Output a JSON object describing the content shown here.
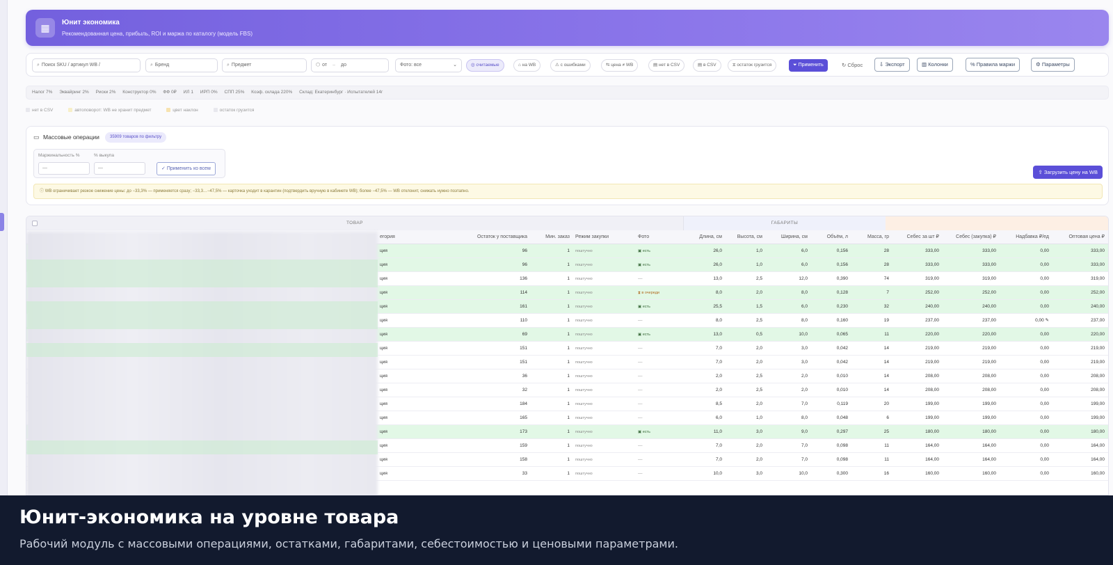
{
  "hero": {
    "title": "Юнит экономика",
    "subtitle": "Рекомендованная цена, прибыль, ROI и маржа по каталогу (модель FBS)"
  },
  "toolbar": {
    "search_placeholder": "Поиск SKU / артикул WB /",
    "brand_placeholder": "Бренд",
    "subject_placeholder": "Предмет",
    "from_placeholder": "от",
    "to_placeholder": "до",
    "photo_select": "Фото: все",
    "chips": [
      "считаемые",
      "на WB",
      "с ошибками",
      "цена ≠ WB",
      "нет в CSV",
      "в CSV",
      "остаток грузится"
    ],
    "apply": "Применить",
    "reset": "Сброс",
    "export": "Экспорт",
    "columns": "Колонки",
    "margin_rules": "Правила маржи",
    "parameters": "Параметры"
  },
  "params": [
    "Налог 7%",
    "Эквайринг 2%",
    "Риски 2%",
    "Конструктор 0%",
    "ФФ 0₽",
    "ИЛ 1",
    "ИРП 0%",
    "СПП 25%",
    "Коэф. склада 220%",
    "Склад: Екатеринбург · Испытателей 14г"
  ],
  "legend": [
    {
      "label": "нет в CSV",
      "color": "#e8e8ee"
    },
    {
      "label": "автоповорот: WB не хранит предмет",
      "color": "#f7efc8"
    },
    {
      "label": "цвет наклон",
      "color": "#f7e3b0"
    },
    {
      "label": "остаток грузится",
      "color": "#e8e8ee"
    }
  ],
  "mass": {
    "title": "Массовые операции",
    "badge": "35909 товаров по фильтру",
    "margin_label": "Маржинальность %",
    "payout_label": "% выкупа",
    "margin_value": "—",
    "payout_value": "—",
    "apply_all": "Применить ко всем",
    "upload": "Загрузить цену на WB",
    "warning": "WB ограничивает резкое снижение цены: до −33,3% — применяется сразу; −33,3…−47,5% — карточка уходит в карантин (подтвердить вручную в кабинете WB); более −47,5% — WB отклонит, снижать нужно поэтапно."
  },
  "table": {
    "group_product": "ТОВАР",
    "group_dims": "ГАБАРИТЫ",
    "headers": [
      "егория",
      "Остаток у поставщика",
      "Мин. заказ",
      "Режим закупки",
      "Фото",
      "Длина, см",
      "Высота, см",
      "Ширина, см",
      "Объём, л",
      "Масса, гр",
      "Себес за шт ₽",
      "Себес (закупка) ₽",
      "Надбавка ₽/ед",
      "Оптовая цена ₽"
    ],
    "rows": [
      {
        "cat": "ция",
        "stock": "96",
        "min": "1",
        "mode": "поштучно",
        "photo": "есть",
        "l": "26,0",
        "h": "1,0",
        "w": "6,0",
        "vol": "0,156",
        "mass": "28",
        "cost": "333,00",
        "buy": "333,00",
        "markup": "0,00",
        "wholesale": "333,00",
        "style": "green"
      },
      {
        "cat": "ция",
        "stock": "96",
        "min": "1",
        "mode": "поштучно",
        "photo": "есть",
        "l": "26,0",
        "h": "1,0",
        "w": "6,0",
        "vol": "0,156",
        "mass": "28",
        "cost": "333,00",
        "buy": "333,00",
        "markup": "0,00",
        "wholesale": "333,00",
        "style": "green"
      },
      {
        "cat": "ция",
        "stock": "136",
        "min": "1",
        "mode": "поштучно",
        "photo": "—",
        "l": "13,0",
        "h": "2,5",
        "w": "12,0",
        "vol": "0,390",
        "mass": "74",
        "cost": "319,00",
        "buy": "319,00",
        "markup": "0,00",
        "wholesale": "319,00",
        "style": "white"
      },
      {
        "cat": "ция",
        "stock": "114",
        "min": "1",
        "mode": "поштучно",
        "photo": "в очереди",
        "l": "8,0",
        "h": "2,0",
        "w": "8,0",
        "vol": "0,128",
        "mass": "7",
        "cost": "252,00",
        "buy": "252,00",
        "markup": "0,00",
        "wholesale": "252,00",
        "style": "green"
      },
      {
        "cat": "ция",
        "stock": "161",
        "min": "1",
        "mode": "поштучно",
        "photo": "есть",
        "l": "25,5",
        "h": "1,5",
        "w": "6,0",
        "vol": "0,230",
        "mass": "32",
        "cost": "240,00",
        "buy": "240,00",
        "markup": "0,00",
        "wholesale": "240,00",
        "style": "green"
      },
      {
        "cat": "ция",
        "stock": "110",
        "min": "1",
        "mode": "поштучно",
        "photo": "—",
        "l": "8,0",
        "h": "2,5",
        "w": "8,0",
        "vol": "0,160",
        "mass": "19",
        "cost": "237,00",
        "buy": "237,00",
        "markup": "0,00 ✎",
        "wholesale": "237,00",
        "style": "white"
      },
      {
        "cat": "ция",
        "stock": "69",
        "min": "1",
        "mode": "поштучно",
        "photo": "есть",
        "l": "13,0",
        "h": "0,5",
        "w": "10,0",
        "vol": "0,065",
        "mass": "11",
        "cost": "220,00",
        "buy": "220,00",
        "markup": "0,00",
        "wholesale": "220,00",
        "style": "green"
      },
      {
        "cat": "ция",
        "stock": "151",
        "min": "1",
        "mode": "поштучно",
        "photo": "—",
        "l": "7,0",
        "h": "2,0",
        "w": "3,0",
        "vol": "0,042",
        "mass": "14",
        "cost": "219,00",
        "buy": "219,00",
        "markup": "0,00",
        "wholesale": "219,00",
        "style": "white"
      },
      {
        "cat": "ция",
        "stock": "151",
        "min": "1",
        "mode": "поштучно",
        "photo": "—",
        "l": "7,0",
        "h": "2,0",
        "w": "3,0",
        "vol": "0,042",
        "mass": "14",
        "cost": "219,00",
        "buy": "219,00",
        "markup": "0,00",
        "wholesale": "219,00",
        "style": "white"
      },
      {
        "cat": "ция",
        "stock": "36",
        "min": "1",
        "mode": "поштучно",
        "photo": "—",
        "l": "2,0",
        "h": "2,5",
        "w": "2,0",
        "vol": "0,010",
        "mass": "14",
        "cost": "208,00",
        "buy": "208,00",
        "markup": "0,00",
        "wholesale": "208,00",
        "style": "white"
      },
      {
        "cat": "ция",
        "stock": "32",
        "min": "1",
        "mode": "поштучно",
        "photo": "—",
        "l": "2,0",
        "h": "2,5",
        "w": "2,0",
        "vol": "0,010",
        "mass": "14",
        "cost": "208,00",
        "buy": "208,00",
        "markup": "0,00",
        "wholesale": "208,00",
        "style": "white"
      },
      {
        "cat": "ция",
        "stock": "184",
        "min": "1",
        "mode": "поштучно",
        "photo": "—",
        "l": "8,5",
        "h": "2,0",
        "w": "7,0",
        "vol": "0,119",
        "mass": "20",
        "cost": "199,00",
        "buy": "199,00",
        "markup": "0,00",
        "wholesale": "199,00",
        "style": "white"
      },
      {
        "cat": "ция",
        "stock": "165",
        "min": "1",
        "mode": "поштучно",
        "photo": "—",
        "l": "6,0",
        "h": "1,0",
        "w": "8,0",
        "vol": "0,048",
        "mass": "6",
        "cost": "199,00",
        "buy": "199,00",
        "markup": "0,00",
        "wholesale": "199,00",
        "style": "white"
      },
      {
        "cat": "ция",
        "stock": "173",
        "min": "1",
        "mode": "поштучно",
        "photo": "есть",
        "l": "11,0",
        "h": "3,0",
        "w": "9,0",
        "vol": "0,297",
        "mass": "25",
        "cost": "180,00",
        "buy": "180,00",
        "markup": "0,00",
        "wholesale": "180,00",
        "style": "green"
      },
      {
        "cat": "ция",
        "stock": "159",
        "min": "1",
        "mode": "поштучно",
        "photo": "—",
        "l": "7,0",
        "h": "2,0",
        "w": "7,0",
        "vol": "0,098",
        "mass": "11",
        "cost": "164,00",
        "buy": "164,00",
        "markup": "0,00",
        "wholesale": "164,00",
        "style": "white"
      },
      {
        "cat": "ция",
        "stock": "158",
        "min": "1",
        "mode": "поштучно",
        "photo": "—",
        "l": "7,0",
        "h": "2,0",
        "w": "7,0",
        "vol": "0,098",
        "mass": "11",
        "cost": "164,00",
        "buy": "164,00",
        "markup": "0,00",
        "wholesale": "164,00",
        "style": "white"
      },
      {
        "cat": "ция",
        "stock": "33",
        "min": "1",
        "mode": "поштучно",
        "photo": "—",
        "l": "10,0",
        "h": "3,0",
        "w": "10,0",
        "vol": "0,300",
        "mass": "16",
        "cost": "160,00",
        "buy": "160,00",
        "markup": "0,00",
        "wholesale": "160,00",
        "style": "white"
      }
    ]
  },
  "footer": {
    "title": "Юнит-экономика на уровне товара",
    "subtitle": "Рабочий модуль с массовыми операциями, остатками, габаритами, себестоимостью и ценовыми параметрами."
  }
}
